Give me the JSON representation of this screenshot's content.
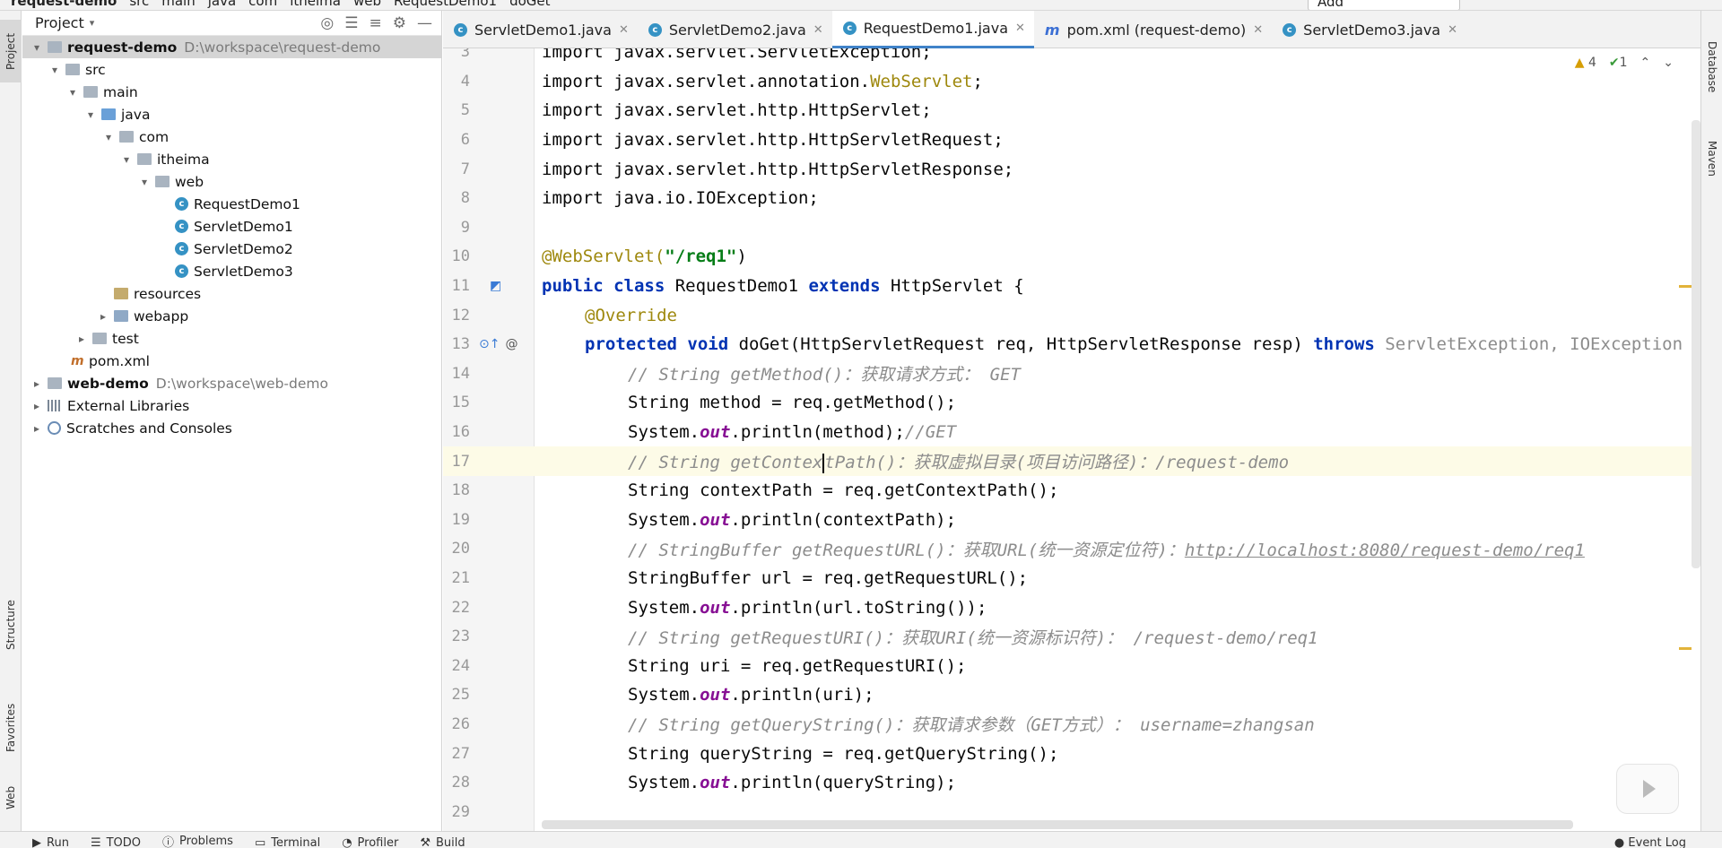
{
  "breadcrumb": [
    "request-demo",
    "src",
    "main",
    "java",
    "com",
    "itheima",
    "web",
    "RequestDemo1",
    "doGet"
  ],
  "toolbar": {
    "add_configuration": "Add Configuration..."
  },
  "left_strip": {
    "project": "Project",
    "structure": "Structure",
    "favorites": "Favorites",
    "web": "Web"
  },
  "right_strip": {
    "database": "Database",
    "maven": "Maven"
  },
  "project_panel": {
    "title": "Project",
    "items": [
      {
        "label": "request-demo",
        "path": "D:\\workspace\\request-demo",
        "arrow": "▾",
        "type": "folder"
      },
      {
        "label": "src",
        "arrow": "▾",
        "type": "folder"
      },
      {
        "label": "main",
        "arrow": "▾",
        "type": "folder"
      },
      {
        "label": "java",
        "arrow": "▾",
        "type": "folder-java"
      },
      {
        "label": "com",
        "arrow": "▾",
        "type": "package"
      },
      {
        "label": "itheima",
        "arrow": "▾",
        "type": "package"
      },
      {
        "label": "web",
        "arrow": "▾",
        "type": "package"
      },
      {
        "label": "RequestDemo1",
        "type": "class"
      },
      {
        "label": "ServletDemo1",
        "type": "class"
      },
      {
        "label": "ServletDemo2",
        "type": "class"
      },
      {
        "label": "ServletDemo3",
        "type": "class"
      },
      {
        "label": "resources",
        "type": "folder-res"
      },
      {
        "label": "webapp",
        "arrow": "▸",
        "type": "folder-web"
      },
      {
        "label": "test",
        "arrow": "▸",
        "type": "folder"
      },
      {
        "label": "pom.xml",
        "type": "maven"
      },
      {
        "label": "web-demo",
        "path": "D:\\workspace\\web-demo",
        "arrow": "▸",
        "type": "folder"
      },
      {
        "label": "External Libraries",
        "arrow": "▸",
        "type": "lib"
      },
      {
        "label": "Scratches and Consoles",
        "arrow": "▸",
        "type": "scratch"
      }
    ]
  },
  "tabs": [
    {
      "label": "ServletDemo1.java",
      "icon": "class-icon"
    },
    {
      "label": "ServletDemo2.java",
      "icon": "class-icon"
    },
    {
      "label": "RequestDemo1.java",
      "icon": "class-icon",
      "active": true
    },
    {
      "label": "pom.xml (request-demo)",
      "icon": "maven-icon"
    },
    {
      "label": "ServletDemo3.java",
      "icon": "class-icon"
    }
  ],
  "inspections": {
    "warnings": "4",
    "ok": "1"
  },
  "code": {
    "l3": {
      "n": "3",
      "t": "import javax.servlet.ServletException;"
    },
    "l4": {
      "n": "4"
    },
    "l5": {
      "n": "5",
      "t": "import javax.servlet.http.HttpServlet;"
    },
    "l6": {
      "n": "6",
      "t": "import javax.servlet.http.HttpServletRequest;"
    },
    "l7": {
      "n": "7",
      "t": "import javax.servlet.http.HttpServletResponse;"
    },
    "l8": {
      "n": "8",
      "t": "import java.io.IOException;"
    },
    "l9": {
      "n": "9"
    },
    "l10": {
      "n": "10"
    },
    "l11": {
      "n": "11"
    },
    "l12": {
      "n": "12",
      "t": "@Override"
    },
    "l13": {
      "n": "13"
    },
    "l14": {
      "n": "14",
      "t": "// String getMethod()：获取请求方式： GET"
    },
    "l15": {
      "n": "15",
      "t": "String method = req.getMethod();"
    },
    "l16": {
      "n": "16"
    },
    "l17": {
      "n": "17"
    },
    "l18": {
      "n": "18",
      "t": "String contextPath = req.getContextPath();"
    },
    "l19": {
      "n": "19"
    },
    "l20": {
      "n": "20"
    },
    "l21": {
      "n": "21",
      "t": "StringBuffer url = req.getRequestURL();"
    },
    "l22": {
      "n": "22"
    },
    "l23": {
      "n": "23",
      "t": "// String getRequestURI()：获取URI(统一资源标识符)： /request-demo/req1"
    },
    "l24": {
      "n": "24",
      "t": "String uri = req.getRequestURI();"
    },
    "l25": {
      "n": "25"
    },
    "l26": {
      "n": "26",
      "t": "// String getQueryString()：获取请求参数（GET方式）： username=zhangsan"
    },
    "l27": {
      "n": "27",
      "t": "String queryString = req.getQueryString();"
    },
    "l28": {
      "n": "28"
    },
    "l29": {
      "n": "29"
    }
  },
  "tokens": {
    "import": "import",
    "l4a": "javax.servlet.annotation.",
    "l4b": "WebServlet",
    ";": ";",
    "webservlet_ann": "@WebServlet(",
    "req1": "\"/req1\"",
    ")": ")",
    "public": "public",
    "class": "class",
    "classname": " RequestDemo1 ",
    "extends": "extends",
    "sup": " HttpServlet {",
    "protected": "protected",
    "void": "void",
    "l13a": " doGet(HttpServletRequest req, HttpServletResponse resp) ",
    "throws": "throws",
    "l13b": " ServletException, IOException {",
    "system": "System.",
    "out": "out",
    "println_method": ".println(method);",
    "cm_get": "//GET",
    "cm17a": "// String getContex",
    "cm17b": "tPath()：获取虚拟目录(项目访问路径)：/request-demo",
    "println_ctx": ".println(contextPath);",
    "cm20a": "// StringBuffer getRequestURL()：获取URL(统一资源定位符)：",
    "cm20b": "http://localhost:8080/request-demo/req1",
    "println_url": ".println(url.toString());",
    "println_uri": ".println(uri);",
    "println_qs": ".println(queryString);"
  },
  "bottom_bar": {
    "run": "Run",
    "todo": "TODO",
    "problems": "Problems",
    "terminal": "Terminal",
    "profiler": "Profiler",
    "build": "Build",
    "event_log": "Event Log"
  }
}
